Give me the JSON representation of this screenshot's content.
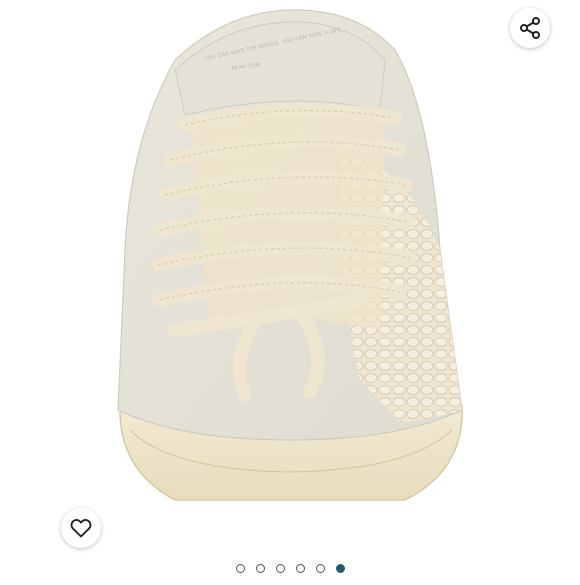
{
  "product_image": {
    "alt": "",
    "insole_stamp_line1": "YOU CAN SAVE THE WORLD. YOU CAN SAVE A LIFE.",
    "insole_stamp_line2": "PEAK.COM"
  },
  "actions": {
    "share_icon": "share-icon",
    "like_icon": "heart-outline-icon"
  },
  "carousel": {
    "total": 6,
    "active_index": 5
  },
  "colors": {
    "accent_dot": "#1f5c6e",
    "background": "#ffffff"
  }
}
